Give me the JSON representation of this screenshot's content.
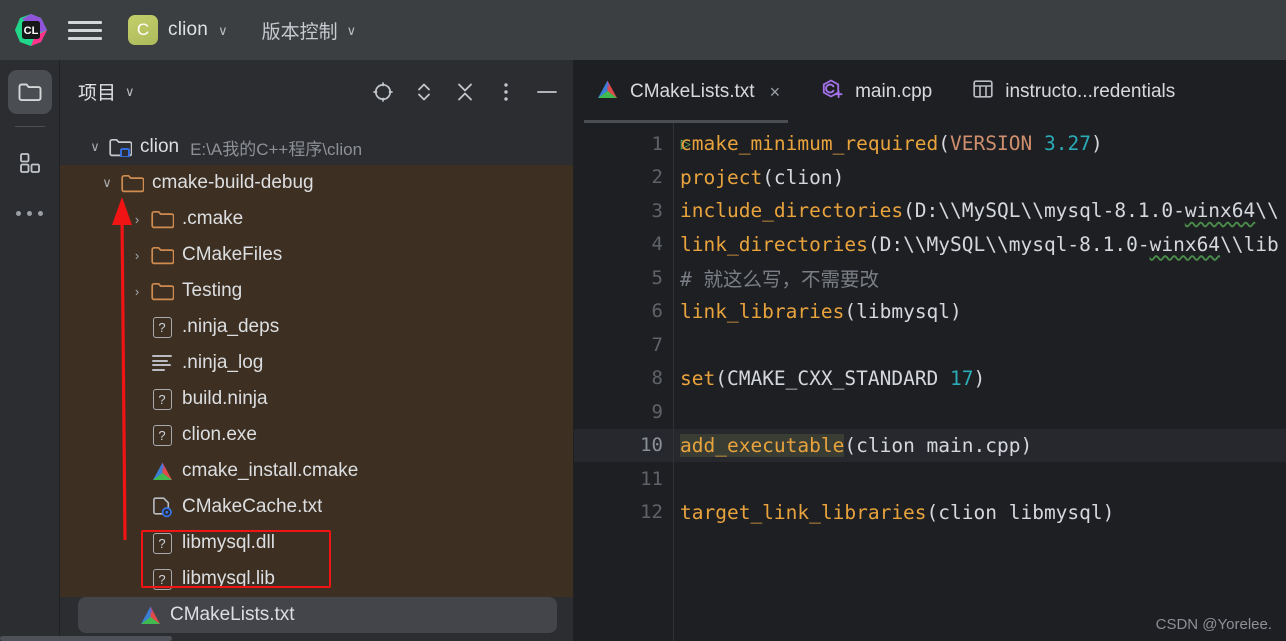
{
  "titlebar": {
    "logo_icon": "clion-logo-icon",
    "menu_icon": "hamburger-menu-icon",
    "project_initial": "C",
    "project_name": "clion",
    "project_chevron": "∨",
    "vcs_label": "版本控制",
    "vcs_chevron": "∨"
  },
  "activitybar": {
    "items": [
      {
        "name": "project-tool-icon",
        "label": "Project",
        "active": true
      },
      {
        "name": "structure-tool-icon",
        "label": "Structure",
        "active": false
      },
      {
        "name": "more-tool-windows-icon",
        "label": "More",
        "active": false
      }
    ]
  },
  "toolwindow": {
    "title": "项目",
    "title_chevron": "∨",
    "actions": [
      {
        "name": "select-opened-file-icon",
        "label": "Select Opened File"
      },
      {
        "name": "expand-collapse-icon",
        "label": "Expand / Collapse"
      },
      {
        "name": "collapse-all-icon",
        "label": "Collapse All"
      },
      {
        "name": "options-menu-icon",
        "label": "Options"
      },
      {
        "name": "hide-tool-window-icon",
        "label": "Hide"
      }
    ],
    "tree": [
      {
        "label": "clion",
        "path": "E:\\A我的C++程序\\clion",
        "icon": "project-folder-icon",
        "arrow": "∨",
        "depth": 0,
        "style": "plain"
      },
      {
        "label": "cmake-build-debug",
        "path": "",
        "icon": "folder-icon",
        "arrow": "∨",
        "depth": 1,
        "style": "brown"
      },
      {
        "label": ".cmake",
        "path": "",
        "icon": "folder-icon",
        "arrow": "›",
        "depth": 2,
        "style": "brown"
      },
      {
        "label": "CMakeFiles",
        "path": "",
        "icon": "folder-icon",
        "arrow": "›",
        "depth": 2,
        "style": "brown"
      },
      {
        "label": "Testing",
        "path": "",
        "icon": "folder-icon",
        "arrow": "›",
        "depth": 2,
        "style": "brown"
      },
      {
        "label": ".ninja_deps",
        "path": "",
        "icon": "unknown-file-icon",
        "arrow": "",
        "depth": 2,
        "style": "brown"
      },
      {
        "label": ".ninja_log",
        "path": "",
        "icon": "log-file-icon",
        "arrow": "",
        "depth": 2,
        "style": "brown"
      },
      {
        "label": "build.ninja",
        "path": "",
        "icon": "unknown-file-icon",
        "arrow": "",
        "depth": 2,
        "style": "brown"
      },
      {
        "label": "clion.exe",
        "path": "",
        "icon": "unknown-file-icon",
        "arrow": "",
        "depth": 2,
        "style": "brown"
      },
      {
        "label": "cmake_install.cmake",
        "path": "",
        "icon": "cmake-file-icon",
        "arrow": "",
        "depth": 2,
        "style": "brown"
      },
      {
        "label": "CMakeCache.txt",
        "path": "",
        "icon": "cmake-cache-icon",
        "arrow": "",
        "depth": 2,
        "style": "brown"
      },
      {
        "label": "libmysql.dll",
        "path": "",
        "icon": "unknown-file-icon",
        "arrow": "",
        "depth": 2,
        "style": "brown"
      },
      {
        "label": "libmysql.lib",
        "path": "",
        "icon": "unknown-file-icon",
        "arrow": "",
        "depth": 2,
        "style": "brown"
      },
      {
        "label": "CMakeLists.txt",
        "path": "",
        "icon": "cmake-file-icon",
        "arrow": "",
        "depth": 1,
        "style": "selected"
      }
    ]
  },
  "editor": {
    "tabs": [
      {
        "label": "CMakeLists.txt",
        "icon": "cmake-file-icon",
        "active": true,
        "closable": true,
        "close_glyph": "×"
      },
      {
        "label": "main.cpp",
        "icon": "cpp-file-icon",
        "active": false,
        "closable": false,
        "close_glyph": ""
      },
      {
        "label": "instructo...redentials",
        "icon": "database-table-icon",
        "active": false,
        "closable": false,
        "close_glyph": ""
      }
    ],
    "run_marker_glyph": "▷",
    "lines": [
      {
        "num": "1",
        "current": false,
        "run_marker": true,
        "tokens": [
          {
            "t": "cmake_minimum_required",
            "c": "fn"
          },
          {
            "t": "(",
            "c": "plain"
          },
          {
            "t": "VERSION",
            "c": "kw"
          },
          {
            "t": " ",
            "c": "plain"
          },
          {
            "t": "3.27",
            "c": "num"
          },
          {
            "t": ")",
            "c": "plain"
          }
        ]
      },
      {
        "num": "2",
        "current": false,
        "run_marker": false,
        "tokens": [
          {
            "t": "project",
            "c": "fn"
          },
          {
            "t": "(clion)",
            "c": "plain"
          }
        ]
      },
      {
        "num": "3",
        "current": false,
        "run_marker": false,
        "tokens": [
          {
            "t": "include_directories",
            "c": "fn"
          },
          {
            "t": "(D:\\\\MySQL\\\\mysql-8.1.0-",
            "c": "plain"
          },
          {
            "t": "winx64",
            "c": "squig"
          },
          {
            "t": "\\\\",
            "c": "plain"
          }
        ]
      },
      {
        "num": "4",
        "current": false,
        "run_marker": false,
        "tokens": [
          {
            "t": "link_directories",
            "c": "fn"
          },
          {
            "t": "(D:\\\\MySQL\\\\mysql-8.1.0-",
            "c": "plain"
          },
          {
            "t": "winx64",
            "c": "squig"
          },
          {
            "t": "\\\\lib",
            "c": "plain"
          }
        ]
      },
      {
        "num": "5",
        "current": false,
        "run_marker": false,
        "tokens": [
          {
            "t": "# 就这么写，不需要改",
            "c": "comment"
          }
        ]
      },
      {
        "num": "6",
        "current": false,
        "run_marker": false,
        "tokens": [
          {
            "t": "link_libraries",
            "c": "fn"
          },
          {
            "t": "(libmysql)",
            "c": "plain"
          }
        ]
      },
      {
        "num": "7",
        "current": false,
        "run_marker": false,
        "tokens": []
      },
      {
        "num": "8",
        "current": false,
        "run_marker": false,
        "tokens": [
          {
            "t": "set",
            "c": "fn"
          },
          {
            "t": "(CMAKE_CXX_STANDARD ",
            "c": "plain"
          },
          {
            "t": "17",
            "c": "num"
          },
          {
            "t": ")",
            "c": "plain"
          }
        ]
      },
      {
        "num": "9",
        "current": false,
        "run_marker": false,
        "tokens": []
      },
      {
        "num": "10",
        "current": true,
        "run_marker": false,
        "tokens": [
          {
            "t": "add_executable",
            "c": "fn-hl"
          },
          {
            "t": "(clion main.cpp)",
            "c": "plain"
          }
        ]
      },
      {
        "num": "11",
        "current": false,
        "run_marker": false,
        "tokens": []
      },
      {
        "num": "12",
        "current": false,
        "run_marker": false,
        "tokens": [
          {
            "t": "target_link_libraries",
            "c": "fn"
          },
          {
            "t": "(clion libmysql)",
            "c": "plain"
          }
        ]
      }
    ]
  },
  "annotations": {
    "highlight_box_label": "libmysql-files-highlight",
    "arrow_label": "cmake-build-debug-pointer-arrow",
    "arrow_color": "#f01414",
    "box_color": "#f01414"
  },
  "watermark": {
    "text": "CSDN @Yorelee."
  },
  "colors": {
    "titlebar_bg": "#3c3f41",
    "tree_brown_bg": "#3d3022",
    "panel_bg": "#2b2d30",
    "editor_bg": "#1e1f22",
    "current_line_bg": "#26282e",
    "accent_green": "#aebb5c",
    "keyword": "#cf8e6d",
    "function": "#e8a33d",
    "number": "#2aacb8",
    "comment": "#7a7e85"
  }
}
